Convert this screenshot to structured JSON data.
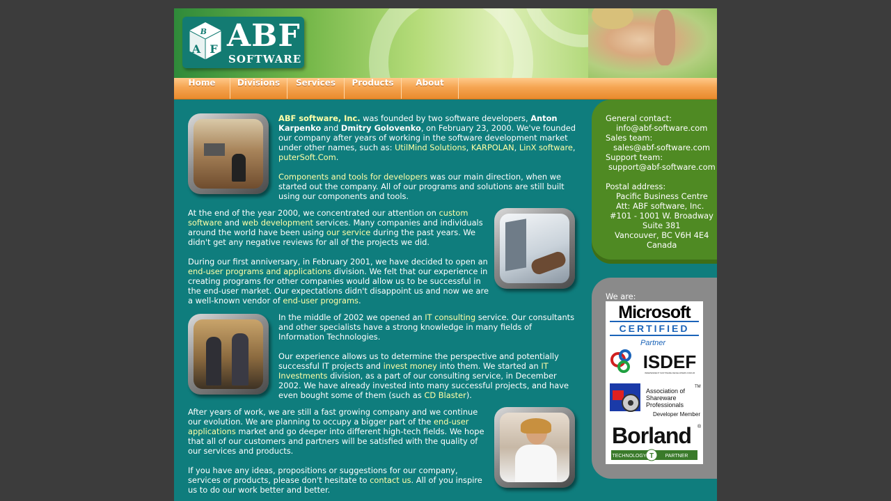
{
  "logo": {
    "big": "ABF",
    "small": "SOFTWARE",
    "cube_letters": [
      "A",
      "B",
      "F"
    ]
  },
  "nav": {
    "items": [
      "Home",
      "Divisions",
      "Services",
      "Products",
      "About"
    ]
  },
  "content": {
    "p1": {
      "name1": "ABF software, Inc.",
      "t1": " was founded by two software developers, ",
      "name2": "Anton Karpenko",
      "t2": " and ",
      "name3": "Dmitry Golovenko",
      "t3": ", on February 23, 2000. We've founded our company after years of working in the software development market under other names, such as: ",
      "l1": "UtilMind Solutions",
      "c1": ", ",
      "l2": "KARPOLAN",
      "c2": ", ",
      "l3": "LinX software",
      "c3": ", ",
      "l4": "puterSoft.Com",
      "end": "."
    },
    "p2": {
      "l1": "Components and tools for developers",
      "t1": " was our main direction, when we started out the company. All of our programs and solutions are still built using our components and tools."
    },
    "p3": {
      "t1": "At the end of the year 2000, we concentrated our attention on ",
      "l1": "custom software",
      "t2": " and ",
      "l2": "web development",
      "t3": " services. Many companies and individuals around the world have been using ",
      "l3": "our service",
      "t4": " during the past years. We didn't get any negative reviews for all of the projects we did."
    },
    "p4": {
      "t1": "During our first anniversary, in February 2001, we have decided to open an ",
      "l1": "end-user programs and applications",
      "t2": " division. We felt that our experience in creating programs for other companies would allow us to be successful in the end-user market. Our expectations didn't disappoint us and now we are a well-known vendor of ",
      "l2": "end-user programs",
      "t3": "."
    },
    "p5": {
      "t1": "In the middle of 2002 we opened an ",
      "l1": "IT consulting",
      "t2": " service. Our consultants and other specialists have a strong knowledge in many fields of Information Technologies."
    },
    "p6": {
      "t1": "Our experience allows us to determine the perspective and potentially successful IT projects and ",
      "l1": "invest money",
      "t2": " into them. We started an ",
      "l2": "IT Investments",
      "t3": " division, as a part of our consulting service, in December 2002. We have already invested into many successful projects, and have even bought some of them (such as ",
      "l3": "CD Blaster",
      "t4": ")."
    },
    "p7": {
      "t1": "After years of work, we are still a fast growing company and we continue our evolution. We are planning to occupy a bigger part of the ",
      "l1": "end-user applications",
      "t2": " market and go deeper into different high-tech fields. We hope that all of our customers and partners will be satisfied with the quality of our services and products."
    },
    "p8": {
      "t1": "If you have any ideas, propositions or suggestions for our company, services or products, please don't hesitate to ",
      "l1": "contact us",
      "t2": ". All of you inspire us to do our work better and better."
    }
  },
  "contact": {
    "general_label": "General contact:",
    "general_email": "info@abf-software.com",
    "sales_label": "Sales team:",
    "sales_email": "sales@abf-software.com",
    "support_label": "Support team:",
    "support_email": "support@abf-software.com",
    "postal_label": "Postal address:",
    "postal_lines": [
      "Pacific Business Centre",
      "Att: ABF software, Inc.",
      "#101 - 1001 W. Broadway",
      "Suite 381",
      "Vancouver, BC V6H 4E4",
      "Canada"
    ]
  },
  "partners": {
    "label": "We are:",
    "microsoft": {
      "name": "Microsoft",
      "certified": "CERTIFIED",
      "partner": "Partner"
    },
    "isdef": {
      "name": "ISDEF",
      "sub": "INDEPENDENT SOFTWARE DEVELOPERS FORUM"
    },
    "asp": {
      "line1": "Association of",
      "line2": "Shareware",
      "line3": "Professionals",
      "member": "Developer Member",
      "tm": "TM"
    },
    "borland": {
      "name": "Borland",
      "reg": "®",
      "tech": "TECHNOLOGY",
      "t": "T",
      "partner": "PARTNER"
    }
  },
  "colors": {
    "page_bg": "#3c3c3c",
    "content_bg": "#0f7d7d",
    "nav": "#f5a552",
    "link": "#ffffa8",
    "sidebar_green": "#4f8a23",
    "sidebar_gray": "#8a8a8a"
  }
}
